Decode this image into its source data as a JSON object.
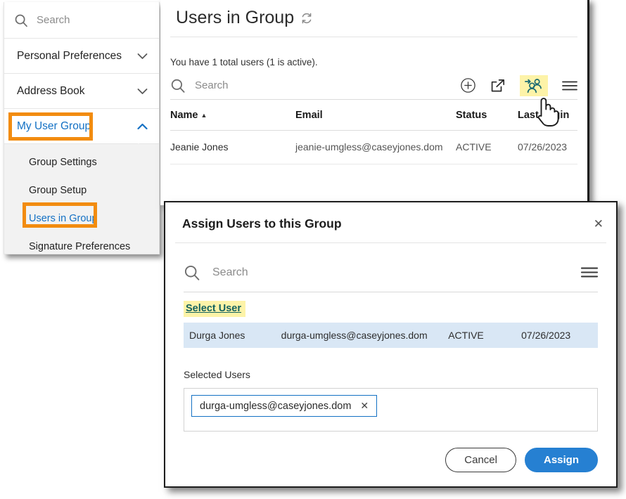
{
  "sidebar": {
    "search": {
      "placeholder": "Search",
      "icon": "search-icon"
    },
    "items": [
      {
        "label": "Personal Preferences",
        "chevron": "chevron-down-icon",
        "expanded": false
      },
      {
        "label": "Address Book",
        "chevron": "chevron-down-icon",
        "expanded": false
      },
      {
        "label": "My User Group",
        "chevron": "chevron-up-icon",
        "expanded": true,
        "highlighted": true
      }
    ],
    "submenu": [
      {
        "label": "Group Settings",
        "active": false
      },
      {
        "label": "Group Setup",
        "active": false
      },
      {
        "label": "Users in Group",
        "active": true,
        "highlighted": true
      },
      {
        "label": "Signature Preferences",
        "active": false
      }
    ]
  },
  "main": {
    "title": "Users in Group",
    "refresh_icon": "refresh-icon",
    "count_text": "You have 1 total users (1 is active).",
    "search": {
      "placeholder": "Search",
      "icon": "search-icon"
    },
    "toolbar_icons": [
      {
        "name": "add-circle-icon",
        "highlighted": false
      },
      {
        "name": "share-export-icon",
        "highlighted": false
      },
      {
        "name": "assign-users-icon",
        "highlighted": true,
        "color": "#1b6b73"
      },
      {
        "name": "hamburger-menu-icon",
        "highlighted": false
      }
    ],
    "table": {
      "columns": [
        "Name",
        "Email",
        "Status",
        "Last Login"
      ],
      "sorted_column": "Name",
      "sort_direction": "asc",
      "rows": [
        {
          "name": "Jeanie Jones",
          "email": "jeanie-umgless@caseyjones.dom",
          "status": "ACTIVE",
          "last_login": "07/26/2023"
        }
      ]
    }
  },
  "modal": {
    "title": "Assign Users to this Group",
    "close_icon": "close-icon",
    "search": {
      "placeholder": "Search",
      "icon": "search-icon"
    },
    "menu_icon": "hamburger-menu-icon",
    "select_user_link": "Select User",
    "result_row": {
      "name": "Durga Jones",
      "email": "durga-umgless@caseyjones.dom",
      "status": "ACTIVE",
      "last_login": "07/26/2023"
    },
    "selected_users_label": "Selected Users",
    "selected_chips": [
      {
        "label": "durga-umgless@caseyjones.dom",
        "remove_icon": "close-icon"
      }
    ],
    "buttons": {
      "cancel": "Cancel",
      "assign": "Assign"
    }
  },
  "colors": {
    "annotation": "#f28c0f",
    "highlight": "#fdf3a8",
    "link": "#1471c4",
    "primary_button": "#2680d2",
    "row_selected": "#d9e7f5",
    "teal": "#1b6b73"
  }
}
